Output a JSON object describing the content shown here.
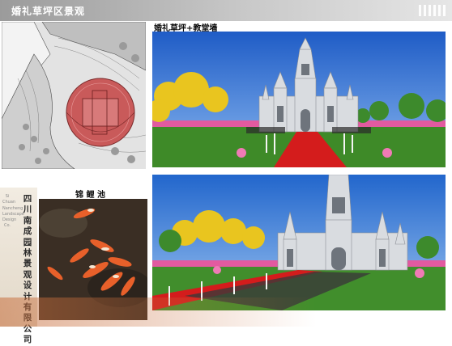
{
  "header": {
    "title": "婚礼草坪区景观"
  },
  "labels": {
    "render_top": "婚礼草坪+教堂墙",
    "koi_pond": "锦 鲤 池"
  },
  "company": {
    "name_cn": "四川南成园林景观设计有限公司",
    "name_en_stack": "Si Chuan Nancheng Landscape Design Co."
  },
  "colors": {
    "header": "#9b9b9b",
    "highlight": "#c85a5a",
    "carpet": "#d81e1e",
    "sky": "#2a6fd8",
    "grass": "#3f8a2a"
  }
}
